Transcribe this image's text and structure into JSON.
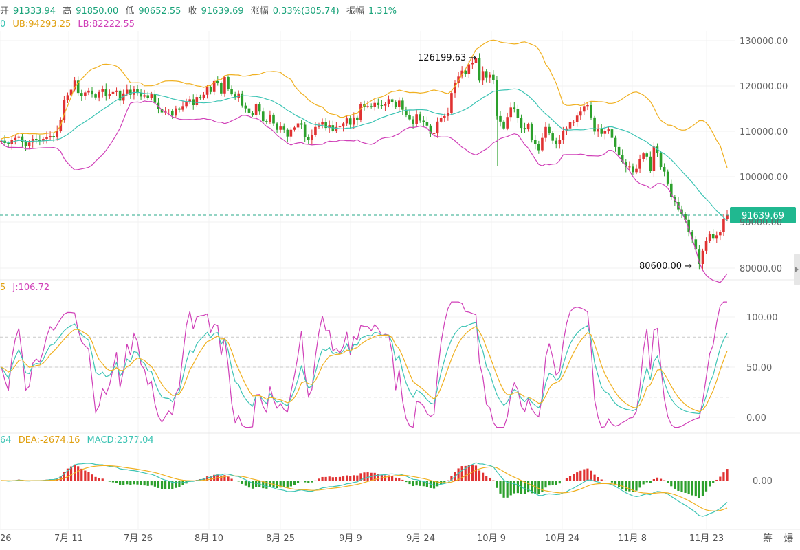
{
  "header": {
    "open_label": "开",
    "open": "91333.94",
    "high_label": "高",
    "high": "91850.00",
    "low_label": "低",
    "low": "90652.55",
    "close_label": "收",
    "close": "91639.69",
    "change_label": "涨幅",
    "change": "0.33%(305.74)",
    "amplitude_label": "振幅",
    "amplitude": "1.31%"
  },
  "boll_legend": {
    "mid": "0",
    "ub": "UB:94293.25",
    "lb": "LB:82222.55"
  },
  "kdj_legend": {
    "d": "5",
    "j": "J:106.72"
  },
  "macd_legend": {
    "dif": "64",
    "dea": "DEA:-2674.16",
    "macd": "MACD:2377.04"
  },
  "price_tag": "91639.69",
  "footer_right": "筹 爆",
  "colors": {
    "up": "#e03232",
    "down": "#2ca02c",
    "mid": "#3cc4b4",
    "ub": "#f0b020",
    "lb": "#d040b8",
    "k": "#3cc4b4",
    "d": "#f0b020",
    "j": "#d040b8"
  },
  "chart_data": {
    "type": "candlestick",
    "x_ticks": [
      "26",
      "7月 11",
      "7月 26",
      "8月 10",
      "8月 25",
      "9月 9",
      "9月 24",
      "10月 9",
      "10月 24",
      "11月 8",
      "11月 23"
    ],
    "price_axis": {
      "ticks": [
        "130000.00",
        "120000.00",
        "110000.00",
        "100000.00",
        "90000.00",
        "80000.00"
      ],
      "range": [
        80000,
        130000
      ]
    },
    "annotations": [
      {
        "text": "126199.63 →",
        "value": 126199.63
      },
      {
        "text": "80600.00 →",
        "value": 80600
      }
    ],
    "current_price": 91639.69,
    "kdj_axis": {
      "ticks": [
        "100.00",
        "50.00",
        "0.00"
      ],
      "range": [
        0,
        100
      ],
      "guides": [
        80,
        50,
        20
      ]
    },
    "macd_axis": {
      "ticks": [
        "0.00"
      ]
    },
    "candles_close": [
      108000,
      107500,
      107200,
      108200,
      108600,
      108900,
      107800,
      106800,
      107600,
      108400,
      108100,
      107900,
      108400,
      108800,
      109000,
      108700,
      110200,
      112500,
      117000,
      118000,
      119200,
      121200,
      118500,
      117900,
      118600,
      119000,
      118200,
      117500,
      118700,
      119400,
      117900,
      118300,
      118700,
      119000,
      116800,
      118400,
      119200,
      118100,
      119300,
      118500,
      117700,
      118000,
      117400,
      118200,
      116300,
      115000,
      114200,
      114600,
      114600,
      113500,
      115100,
      114800,
      115600,
      116400,
      117100,
      115800,
      117600,
      117400,
      118100,
      119800,
      118700,
      121100,
      120700,
      118400,
      122000,
      119300,
      118200,
      117400,
      118400,
      115700,
      115100,
      114000,
      113600,
      116000,
      114400,
      112300,
      112100,
      113700,
      111800,
      110400,
      111100,
      110400,
      108900,
      110400,
      110900,
      111800,
      111500,
      108700,
      108200,
      109300,
      111000,
      111500,
      112100,
      110800,
      111400,
      110200,
      111000,
      111100,
      111800,
      112900,
      111500,
      113100,
      112500,
      116000,
      115500,
      115600,
      115400,
      116300,
      115800,
      115700,
      116000,
      117100,
      116500,
      115500,
      116800,
      114800,
      113600,
      112700,
      111600,
      113800,
      112400,
      112100,
      111300,
      109500,
      109600,
      112200,
      113000,
      113400,
      114100,
      118500,
      120700,
      122100,
      123400,
      122700,
      124800,
      125100,
      126200,
      121200,
      123300,
      121900,
      122500,
      121300,
      113400,
      112200,
      110700,
      113200,
      115300,
      115000,
      113000,
      110800,
      110500,
      111600,
      108200,
      107200,
      105900,
      108600,
      111000,
      109600,
      108000,
      107200,
      108100,
      110200,
      110700,
      112100,
      112100,
      113500,
      114400,
      115600,
      115800,
      113100,
      110000,
      110600,
      109500,
      110200,
      110500,
      108600,
      106600,
      104900,
      103400,
      102200,
      102300,
      101100,
      101800,
      103900,
      105200,
      104500,
      101300,
      106700,
      105300,
      102200,
      101200,
      98600,
      95700,
      94500,
      92900,
      91800,
      90600,
      88000,
      86300,
      84200,
      80900,
      83800,
      86000,
      87500,
      86600,
      87200,
      87900,
      90800,
      91639
    ]
  }
}
